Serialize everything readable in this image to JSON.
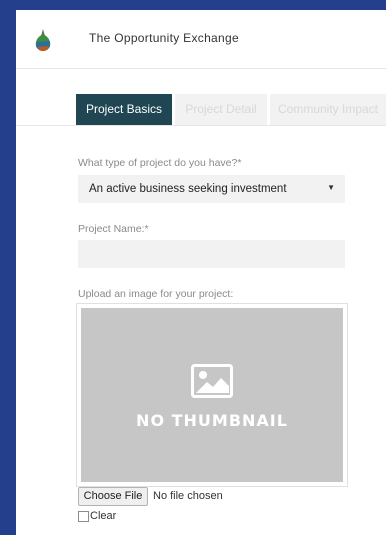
{
  "header": {
    "site_title": "The Opportunity Exchange",
    "logo_icon": "droplet-leaf-logo-icon"
  },
  "tabs": [
    {
      "label": "Project Basics",
      "active": true
    },
    {
      "label": "Project Detail",
      "active": false
    },
    {
      "label": "Community Impact",
      "active": false
    }
  ],
  "form": {
    "project_type": {
      "label": "What type of project do you have?*",
      "selected": "An active business seeking investment"
    },
    "project_name": {
      "label": "Project Name:*",
      "value": ""
    },
    "upload": {
      "label": "Upload an image for your project:",
      "placeholder_text": "NO THUMBNAIL",
      "placeholder_icon": "image-icon",
      "choose_file_label": "Choose File",
      "file_status": "No file chosen",
      "clear_label": "Clear",
      "clear_checked": false
    }
  },
  "colors": {
    "frame": "#243f8b",
    "active_tab": "#1f4652",
    "field_bg": "#f2f2f2",
    "thumbnail_bg": "#c6c6c6"
  }
}
